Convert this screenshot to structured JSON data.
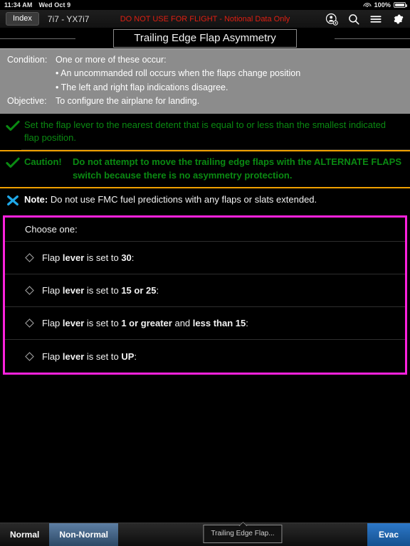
{
  "status_bar": {
    "time": "11:34 AM",
    "date": "Wed Oct 9",
    "battery_percent": "100%",
    "wifi_icon": "wifi-icon",
    "battery_icon": "battery-icon"
  },
  "toolbar": {
    "index_label": "Index",
    "document_id": "7i7 - YX7i7",
    "warning_banner": "DO NOT USE FOR FLIGHT - Notional Data Only",
    "icons": [
      {
        "name": "person-add-icon"
      },
      {
        "name": "search-icon"
      },
      {
        "name": "menu-icon"
      },
      {
        "name": "gear-icon"
      }
    ]
  },
  "page": {
    "title": "Trailing Edge Flap Asymmetry"
  },
  "condition": {
    "condition_label": "Condition:",
    "condition_text": "One or more of these occur:",
    "bullets": [
      "• An uncommanded roll occurs when the flaps change position",
      "• The left and right flap indications disagree."
    ],
    "objective_label": "Objective:",
    "objective_text": "To configure the airplane for landing."
  },
  "steps": [
    {
      "icon": "green-checkmark-icon",
      "text": "Set the flap lever to the nearest detent that is equal to or less than the smallest indicated flap position."
    }
  ],
  "caution": {
    "icon": "green-checkmark-icon",
    "label": "Caution!",
    "text": "Do not attempt to move the trailing edge flaps with the ALTERNATE FLAPS switch because there is no asymmetry protection.",
    "border_color": "#f0a000"
  },
  "note": {
    "icon": "blue-x-icon",
    "label": "Note:",
    "text": "Do not use FMC fuel predictions with any flaps or slats extended."
  },
  "choose_one": {
    "heading": "Choose one:",
    "border_color": "#ff22dd",
    "options": [
      {
        "icon": "diamond-icon",
        "prefix": "Flap ",
        "bold1": "lever",
        "middle": " is set to ",
        "bold2": "30",
        "suffix": ":"
      },
      {
        "icon": "diamond-icon",
        "prefix": "Flap ",
        "bold1": "lever",
        "middle": " is set to ",
        "bold2": "15 or 25",
        "suffix": ":"
      },
      {
        "icon": "diamond-icon",
        "prefix": "Flap ",
        "bold1": "lever",
        "middle": " is set to ",
        "bold2": "1 or greater",
        "middle2": " and ",
        "bold3": "less than 15",
        "suffix": ":"
      },
      {
        "icon": "diamond-icon",
        "prefix": "Flap ",
        "bold1": "lever",
        "middle": " is set to ",
        "bold2": "UP",
        "suffix": ":"
      }
    ]
  },
  "bottom_bar": {
    "tab_normal": "Normal",
    "tab_non_normal": "Non-Normal",
    "tab_selected": "Non-Normal",
    "breadcrumb": "Trailing Edge Flap...",
    "evac_label": "Evac"
  }
}
